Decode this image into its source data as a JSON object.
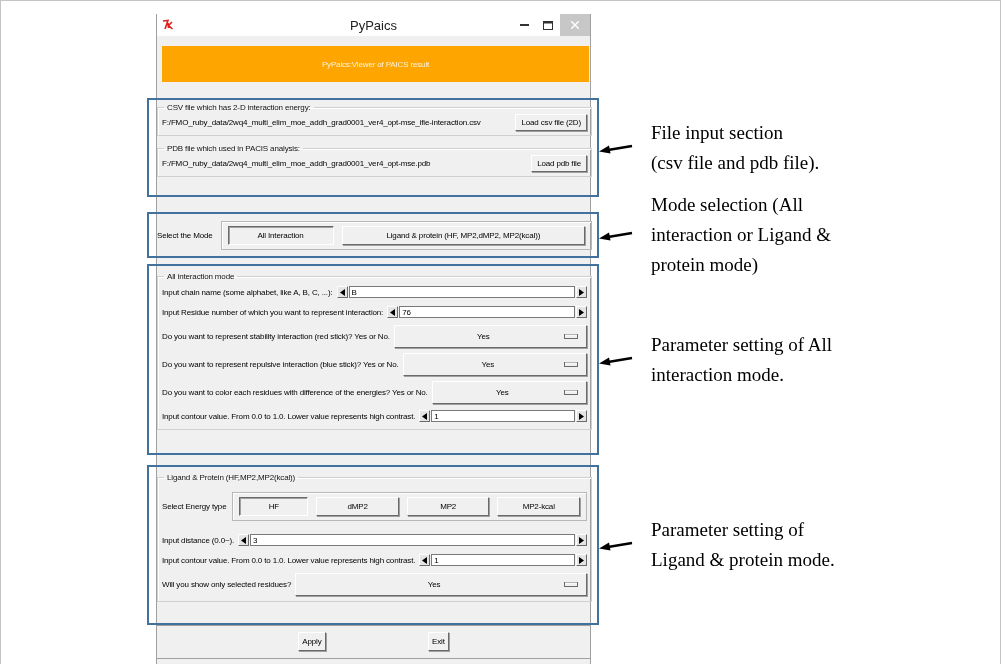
{
  "window": {
    "title": "PyPaics"
  },
  "banner": "PyPaics:Viewer of PAICS result",
  "file_input": [
    {
      "label": "CSV file which has 2-D interaction energy:",
      "path": "F:/FMO_ruby_data/2wq4_multi_elim_moe_addh_grad0001_ver4_opt-mse_ifie-interaction.csv",
      "button": "Load csv file (2D)"
    },
    {
      "label": "PDB file which used in PACIS analysis:",
      "path": "F:/FMO_ruby_data/2wq4_multi_elim_moe_addh_grad0001_ver4_opt-mse.pdb",
      "button": "Load pdb file"
    }
  ],
  "mode": {
    "label": "Select the Mode",
    "options": [
      {
        "label": "All Interaction",
        "selected": true
      },
      {
        "label": "Ligand & protein (HF, MP2,dMP2, MP2(kcal))",
        "selected": false
      }
    ]
  },
  "all_interaction": {
    "title": "All interaction mode",
    "rows": [
      {
        "kind": "spin",
        "label": "Input chain name (some alphabet, like A, B, C, ...):",
        "value": "B"
      },
      {
        "kind": "spin",
        "label": "Input Residue number of which you want to represent interaction:",
        "value": "76"
      },
      {
        "kind": "menu",
        "label": "Do you want to represent stability interaction (red stick)? Yes or No.",
        "value": "Yes"
      },
      {
        "kind": "menu",
        "label": "Do you want to represent repulsive interaction (blue stick)? Yes or No.",
        "value": "Yes"
      },
      {
        "kind": "menu",
        "label": "Do you want to color each residues with difference of the energies? Yes or No.",
        "value": "Yes"
      },
      {
        "kind": "spin",
        "label": "Input contour value. From 0.0 to 1.0. Lower value represents high contrast.",
        "value": "1"
      }
    ]
  },
  "ligand_protein": {
    "title": "Ligand & Protein (HF,MP2,MP2(kcal))",
    "energy_label": "Select Energy type",
    "energy_types": [
      {
        "label": "HF",
        "selected": true
      },
      {
        "label": "dMP2",
        "selected": false
      },
      {
        "label": "MP2",
        "selected": false
      },
      {
        "label": "MP2-kcal",
        "selected": false
      }
    ],
    "rows": [
      {
        "kind": "spin",
        "label": "Input distance (0.0~).",
        "value": "3"
      },
      {
        "kind": "spin",
        "label": "Input contour value. From 0.0 to 1.0. Lower value represents high contrast.",
        "value": "1"
      },
      {
        "kind": "menu",
        "label": "Will you show only selected residues?",
        "value": "Yes"
      }
    ]
  },
  "buttons": [
    "Apply",
    "Exit"
  ],
  "annotations": [
    {
      "lines": [
        "File input section",
        "(csv file and pdb file)."
      ]
    },
    {
      "lines": [
        "Mode selection (All",
        "interaction or Ligand &",
        "protein mode)"
      ]
    },
    {
      "lines": [
        "Parameter setting of All",
        "interaction mode."
      ]
    },
    {
      "lines": [
        "Parameter setting of",
        "Ligand & protein mode."
      ]
    }
  ]
}
